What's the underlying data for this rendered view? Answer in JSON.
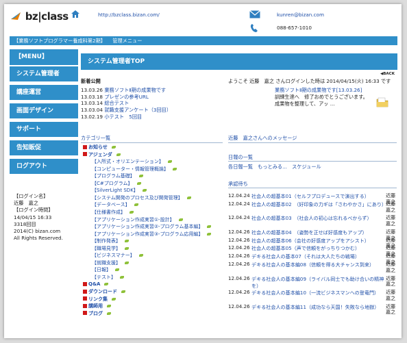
{
  "header": {
    "logo_text": "bz|class",
    "url": "http://bzclass.bizan.com/",
    "email": "kunren@bizan.com",
    "phone": "088-657-1010",
    "course": "【業務ソフトプログラマー養成科第2期】",
    "page": "管理メニュー"
  },
  "sidebar": {
    "heading": "【MENU】",
    "items": [
      {
        "label": "システム管理者"
      },
      {
        "label": "講座運営"
      },
      {
        "label": "画面デザイン"
      },
      {
        "label": "サポート"
      },
      {
        "label": "告知販促"
      },
      {
        "label": "ログアウト"
      }
    ],
    "info": [
      "【ログイン名】",
      "近藤　嘉之",
      "【ログイン時間】",
      "14/04/15 16:33",
      "3318回目",
      "2014(C) bizan.com",
      "All Rights Reserved."
    ]
  },
  "main": {
    "title": "システム管理者TOP",
    "back_label": "BACK",
    "news_heading": "新着公開",
    "news": [
      {
        "date": "13.03.26",
        "text": "業務ソフトⅡ期の成果物です"
      },
      {
        "date": "13.03.18",
        "text": "プレゼンの参考URL"
      },
      {
        "date": "13.03.14",
        "text": "総合テスト"
      },
      {
        "date": "13.03.04",
        "text": "就職支援アンケート（3回目）"
      },
      {
        "date": "13.02.19",
        "text": "小テスト　5回目"
      }
    ],
    "welcome": "ようこそ 近藤　嘉之 さんログインした時は 2014/04/15(火) 16:33 です",
    "notice_link": "業務ソフトⅡ期の成果物です[13.03.26]",
    "notice_body_1": "訓練生達へ　修了おめでとうございます。",
    "notice_body_2": "成果物を整理して、アッ ...",
    "category_heading": "カテゴリ一覧",
    "categories": [
      {
        "label": "お知らせ",
        "indent": 0,
        "leaf": true,
        "bullet": true
      },
      {
        "label": "アジェンダ",
        "indent": 0,
        "leaf": true,
        "bullet": true
      },
      {
        "label": "【入所式・オリエンテーション】",
        "indent": 1,
        "leaf": true
      },
      {
        "label": "【コンピューター・情報管理概論】",
        "indent": 1,
        "leaf": true
      },
      {
        "label": "【プログラム基礎】",
        "indent": 1,
        "leaf": true
      },
      {
        "label": "【C#プログラム】",
        "indent": 1,
        "leaf": true
      },
      {
        "label": "【SilverLight SDK】",
        "indent": 1,
        "leaf": true
      },
      {
        "label": "【システム開発のプロセス及び開発管理】",
        "indent": 1,
        "leaf": true
      },
      {
        "label": "【データベース】",
        "indent": 1,
        "leaf": true
      },
      {
        "label": "【仕様書作成】",
        "indent": 1,
        "leaf": true
      },
      {
        "label": "【アプリケーション作成実習①-設計】",
        "indent": 1,
        "leaf": true
      },
      {
        "label": "【アプリケーション作成実習②-プログラム基本編】",
        "indent": 1,
        "leaf": true
      },
      {
        "label": "【アプリケーション作成実習③-プログラム応用編】",
        "indent": 1,
        "leaf": true
      },
      {
        "label": "【制作発表】",
        "indent": 1,
        "leaf": true
      },
      {
        "label": "【職場見学】",
        "indent": 1,
        "leaf": true
      },
      {
        "label": "【ビジネスマナー】",
        "indent": 1,
        "leaf": true
      },
      {
        "label": "【就職支援】",
        "indent": 1,
        "leaf": true
      },
      {
        "label": "【日報】",
        "indent": 1,
        "leaf": true
      },
      {
        "label": "【テスト】",
        "indent": 1,
        "leaf": true
      },
      {
        "label": "Q&A",
        "indent": 0,
        "leaf": true,
        "bullet": true
      },
      {
        "label": "ダウンロード",
        "indent": 0,
        "leaf": true,
        "bullet": true
      },
      {
        "label": "リンク集",
        "indent": 0,
        "leaf": true,
        "bullet": true
      },
      {
        "label": "講師用",
        "indent": 0,
        "leaf": true,
        "bullet": true
      },
      {
        "label": "ブログ",
        "indent": 0,
        "leaf": true,
        "bullet": true
      }
    ],
    "message_heading": "近藤　嘉之さんへのメッセージ",
    "diary_heading": "日報の一覧",
    "diary_links": "各日報一覧　もっとみる...　スケジュール",
    "approval_heading": "承認待ち",
    "approvals": [
      {
        "date": "12.04.24",
        "text": "社会人の超基本01（セルフプロデュースで演出する）",
        "name": "近藤　嘉之"
      },
      {
        "date": "12.04.24",
        "text": "社会人の超基本02　（好印象の力ギは「さわやかさ」にあり）",
        "name": "近藤　嘉之"
      },
      {
        "date": "12.04.24",
        "text": "社会人の超基本03　（社会人の初心は忘れるべからず）",
        "name": "近藤　嘉之"
      },
      {
        "date": "12.04.26",
        "text": "社会人の超基本04　（姿勢を正せば好感度もアップ）",
        "name": "近藤　嘉之"
      },
      {
        "date": "12.04.26",
        "text": "社会人の超基本06（会社の好感度アップをアシスト）",
        "name": "近藤　嘉之"
      },
      {
        "date": "12.04.26",
        "text": "社会人の超基本05（声で信頼をがっちりつかむ）",
        "name": "近藤　嘉之"
      },
      {
        "date": "12.04.26",
        "text": "デキる社会人の基本07（それは大人たちの戦場）",
        "name": "近藤　嘉之"
      },
      {
        "date": "12.04.26",
        "text": "デキる社会人の基本編08（信頼を得る大チャンス到来）",
        "name": "近藤　嘉之"
      },
      {
        "date": "12.04.26",
        "text": "デキる社会人の基本編09（ライバル同士でも助け合いの精神を）",
        "name": "近藤　嘉之"
      },
      {
        "date": "12.04.26",
        "text": "デキる社会人の基本編10（一流ビジネスマンへの登竜門）",
        "name": "近藤　嘉之"
      },
      {
        "date": "12.04.26",
        "text": "デキる社会人の基本編11（成功なら天国！失敗なら地獄）",
        "name": "近藤　嘉之"
      }
    ]
  }
}
